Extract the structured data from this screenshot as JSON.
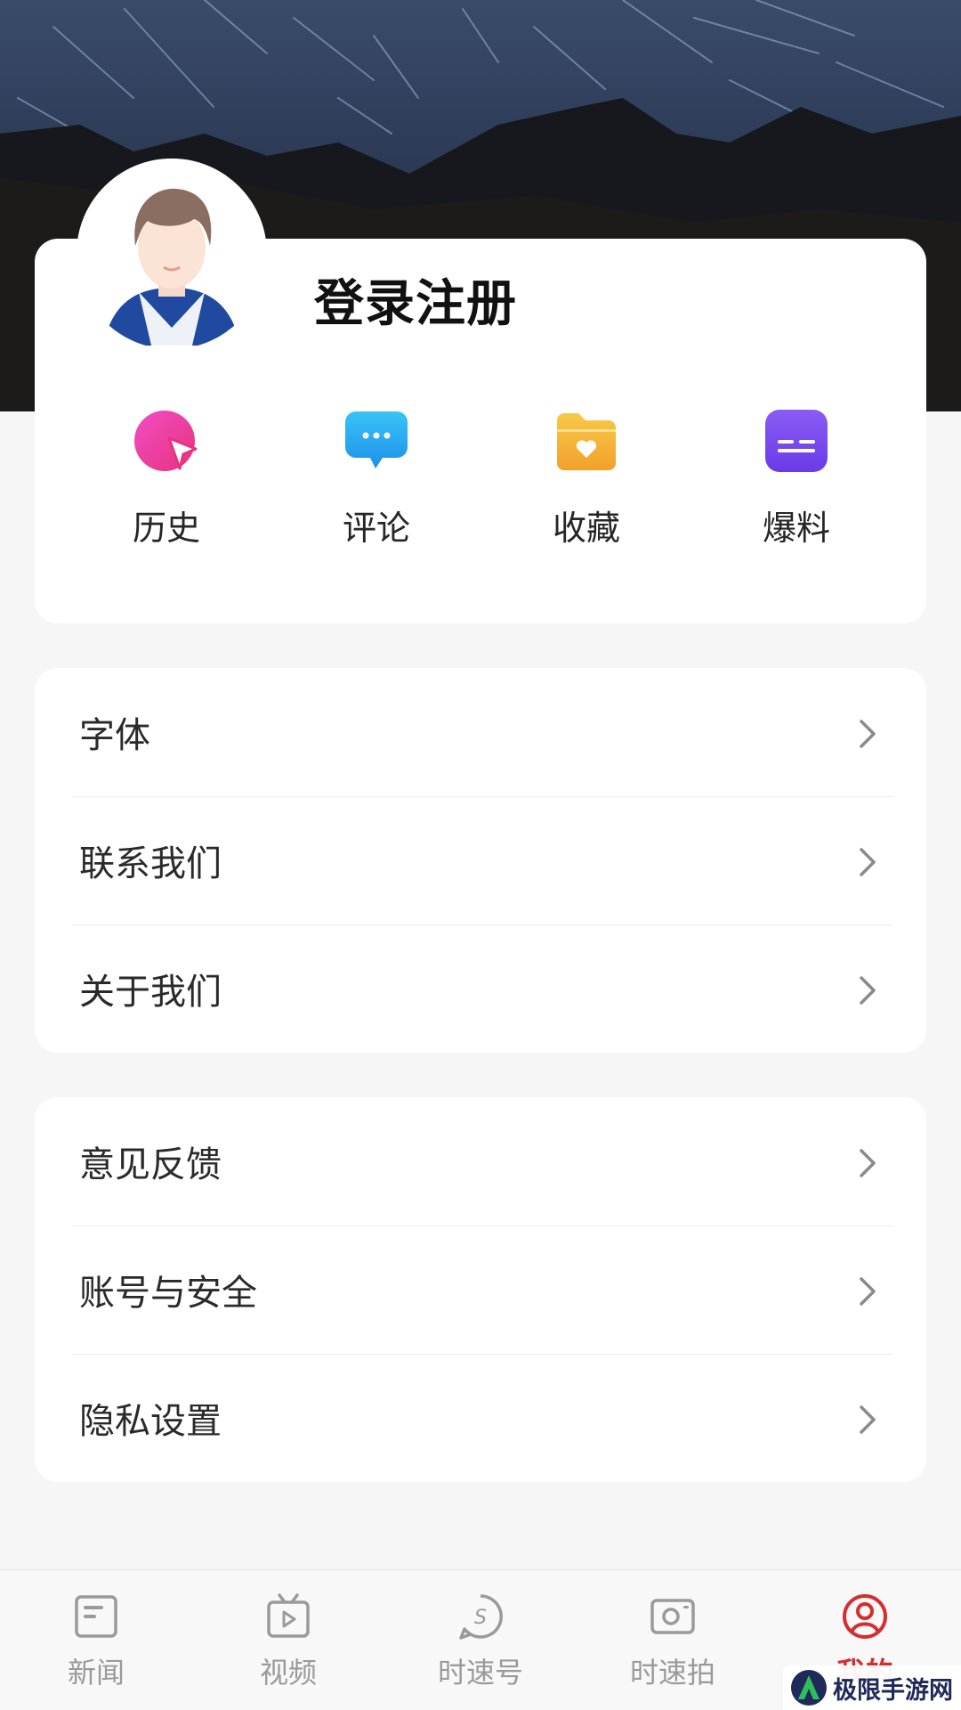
{
  "profile": {
    "login_label": "登录注册"
  },
  "quick_actions": [
    {
      "label": "历史",
      "icon": "history-icon",
      "color": "#e83fb8"
    },
    {
      "label": "评论",
      "icon": "comment-icon",
      "color": "#2fb4f5"
    },
    {
      "label": "收藏",
      "icon": "favorite-folder-icon",
      "color": "#f5b532"
    },
    {
      "label": "爆料",
      "icon": "report-icon",
      "color": "#7b4cf0"
    }
  ],
  "menu_group_1": [
    {
      "label": "字体"
    },
    {
      "label": "联系我们"
    },
    {
      "label": "关于我们"
    }
  ],
  "menu_group_2": [
    {
      "label": "意见反馈"
    },
    {
      "label": "账号与安全"
    },
    {
      "label": "隐私设置"
    }
  ],
  "bottom_nav": [
    {
      "label": "新闻",
      "icon": "news-icon",
      "active": false
    },
    {
      "label": "视频",
      "icon": "video-icon",
      "active": false
    },
    {
      "label": "时速号",
      "icon": "shisuhao-icon",
      "active": false
    },
    {
      "label": "时速拍",
      "icon": "camera-icon",
      "active": false
    },
    {
      "label": "我的",
      "icon": "profile-icon",
      "active": true
    }
  ],
  "colors": {
    "accent": "#d32f2f",
    "inactive": "#9a9a9a"
  },
  "watermark": {
    "text": "极限手游网"
  }
}
